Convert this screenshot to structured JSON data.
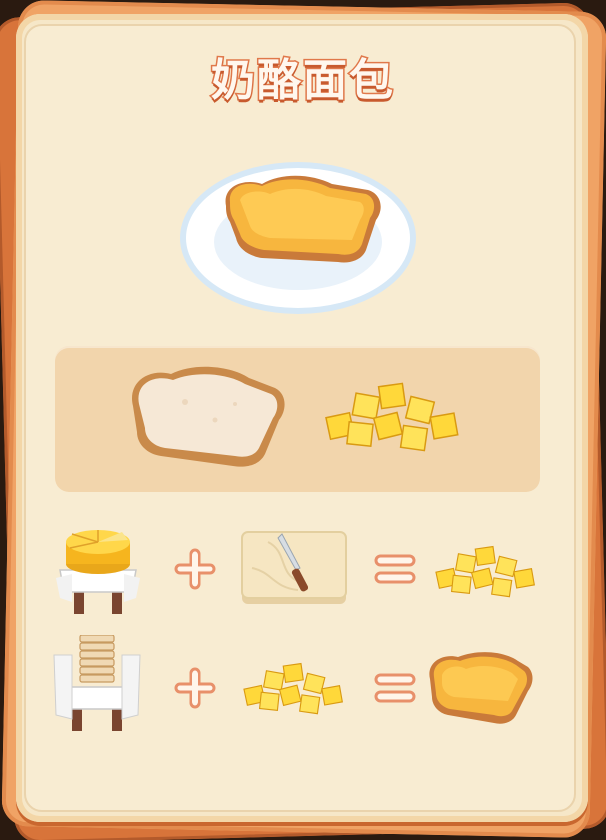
{
  "recipe": {
    "title": "奶酪面包"
  },
  "final_dish": {
    "icon": "cheese-toast-on-plate-icon"
  },
  "ingredients": [
    {
      "icon": "bread-slice-icon"
    },
    {
      "icon": "cheese-cubes-icon"
    }
  ],
  "steps": [
    {
      "station": "cheese-wheel-on-stand-icon",
      "tool": "knife-on-cutting-board-icon",
      "result": "cheese-cubes-icon"
    },
    {
      "station": "bread-stack-on-stand-icon",
      "tool": "cheese-cubes-icon",
      "result": "cheese-toast-icon"
    }
  ],
  "colors": {
    "card_outer": "#d8743a",
    "card_inner": "#f8ecd2",
    "panel": "#f2d5ac",
    "operator": "#e8906a",
    "title_stroke": "#e0784a"
  }
}
